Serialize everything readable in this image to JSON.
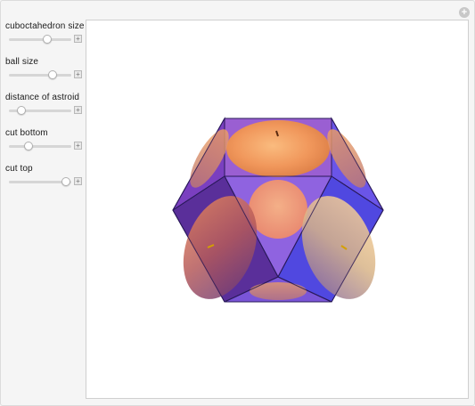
{
  "controls": [
    {
      "label": "cuboctahedron size",
      "value": 0.62
    },
    {
      "label": "ball size",
      "value": 0.7
    },
    {
      "label": "distance of astroid",
      "value": 0.2
    },
    {
      "label": "cut bottom",
      "value": 0.32
    },
    {
      "label": "cut top",
      "value": 0.92
    }
  ],
  "icons": {
    "corner": "plus-circle-icon",
    "slider_expand": "plus-square-icon"
  },
  "colors": {
    "face_blue": "#5b4be8",
    "face_purple": "#8a4fc9",
    "ball_orange": "#f0a05a",
    "edge": "#2a1a5a"
  }
}
